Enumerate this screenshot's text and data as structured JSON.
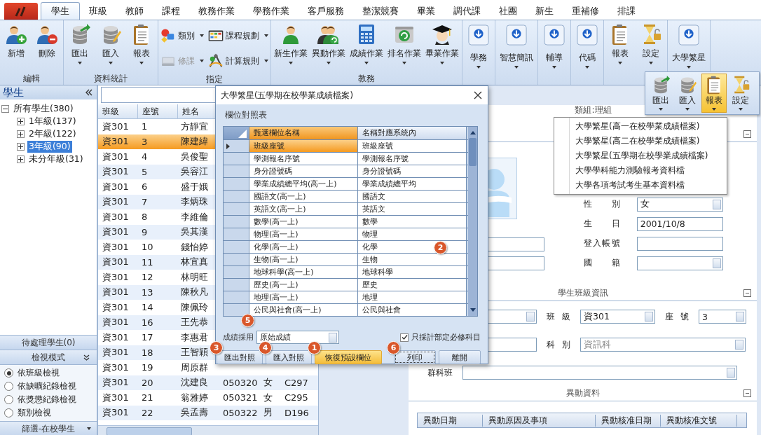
{
  "app_tabs": [
    {
      "label": "學生",
      "selected": true
    },
    {
      "label": "班級",
      "selected": false
    },
    {
      "label": "教師",
      "selected": false
    },
    {
      "label": "課程",
      "selected": false
    },
    {
      "label": "教務作業",
      "selected": false
    },
    {
      "label": "學務作業",
      "selected": false
    },
    {
      "label": "客戶服務",
      "selected": false
    },
    {
      "label": "整潔競賽",
      "selected": false
    },
    {
      "label": "畢業",
      "selected": false
    },
    {
      "label": "調代課",
      "selected": false
    },
    {
      "label": "社團",
      "selected": false
    },
    {
      "label": "新生",
      "selected": false
    },
    {
      "label": "重補修",
      "selected": false
    },
    {
      "label": "排課",
      "selected": false
    }
  ],
  "ribbon_groups": [
    {
      "kind": "large",
      "title": "編輯",
      "buttons": [
        {
          "label": "新增",
          "dropdown": false
        },
        {
          "label": "刪除",
          "dropdown": false
        }
      ]
    },
    {
      "kind": "large",
      "title": "資料統計",
      "buttons": [
        {
          "label": "匯出",
          "dropdown": true
        },
        {
          "label": "匯入",
          "dropdown": true
        },
        {
          "label": "報表",
          "dropdown": true
        }
      ]
    },
    {
      "kind": "small",
      "title": "指定",
      "buttons": [
        {
          "label": "類別",
          "dropdown": true,
          "disabled": false
        },
        {
          "label": "修課",
          "dropdown": true,
          "disabled": true
        },
        {
          "label": "課程規劃",
          "dropdown": true,
          "disabled": false
        },
        {
          "label": "計算規則",
          "dropdown": true,
          "disabled": false
        }
      ]
    },
    {
      "kind": "large",
      "title": "教務",
      "buttons": [
        {
          "label": "新生作業",
          "dropdown": true
        },
        {
          "label": "異動作業",
          "dropdown": true
        },
        {
          "label": "成績作業",
          "dropdown": true
        },
        {
          "label": "排名作業",
          "dropdown": true
        },
        {
          "label": "畢業作業",
          "dropdown": true
        }
      ]
    },
    {
      "kind": "boxed",
      "buttons": [
        {
          "label": "學務",
          "dropdown": true
        }
      ]
    },
    {
      "kind": "boxed",
      "buttons": [
        {
          "label": "智慧簡訊",
          "dropdown": true
        }
      ]
    },
    {
      "kind": "boxed",
      "buttons": [
        {
          "label": "輔導",
          "dropdown": true
        }
      ]
    },
    {
      "kind": "boxed",
      "buttons": [
        {
          "label": "代碼",
          "dropdown": true
        }
      ]
    },
    {
      "kind": "large",
      "buttons": [
        {
          "label": "報表",
          "dropdown": true
        },
        {
          "label": "設定",
          "dropdown": true
        }
      ]
    },
    {
      "kind": "boxed",
      "buttons": [
        {
          "label": "大學繁星",
          "dropdown": true
        }
      ]
    }
  ],
  "side_panel": {
    "title": "學生",
    "tree": {
      "label": "所有學生(380)",
      "expanded": true,
      "selected": false,
      "children": [
        {
          "label": "1年級(137)",
          "expanded": false,
          "selected": false
        },
        {
          "label": "2年級(122)",
          "expanded": false,
          "selected": false
        },
        {
          "label": "3年級(90)",
          "expanded": false,
          "selected": true
        },
        {
          "label": "未分年級(31)",
          "expanded": false,
          "selected": false
        }
      ]
    },
    "pending": "待處理學生(0)",
    "view_mode_title": "檢視模式",
    "view_modes": [
      {
        "label": "依班級檢視",
        "selected": true
      },
      {
        "label": "依缺曠紀錄檢視",
        "selected": false
      },
      {
        "label": "依獎懲紀錄檢視",
        "selected": false
      },
      {
        "label": "類別檢視",
        "selected": false
      }
    ],
    "filter": "篩選-在校學生"
  },
  "student_grid": {
    "columns": [
      "班級",
      "座號",
      "姓名"
    ],
    "rows": [
      {
        "class": "資301",
        "seat": "1",
        "name": "方靜宜",
        "selected": false
      },
      {
        "class": "資301",
        "seat": "3",
        "name": "陳建緯",
        "selected": true
      },
      {
        "class": "資301",
        "seat": "4",
        "name": "吳俊聖",
        "selected": false
      },
      {
        "class": "資301",
        "seat": "5",
        "name": "吳容江",
        "selected": false
      },
      {
        "class": "資301",
        "seat": "6",
        "name": "盛于娥",
        "selected": false
      },
      {
        "class": "資301",
        "seat": "7",
        "name": "李炳珠",
        "selected": false
      },
      {
        "class": "資301",
        "seat": "8",
        "name": "李維倫",
        "selected": false
      },
      {
        "class": "資301",
        "seat": "9",
        "name": "吳其漢",
        "selected": false
      },
      {
        "class": "資301",
        "seat": "10",
        "name": "錢怡婷",
        "selected": false
      },
      {
        "class": "資301",
        "seat": "11",
        "name": "林宜真",
        "selected": false
      },
      {
        "class": "資301",
        "seat": "12",
        "name": "林明旺",
        "selected": false
      },
      {
        "class": "資301",
        "seat": "13",
        "name": "陳秋凡",
        "selected": false
      },
      {
        "class": "資301",
        "seat": "14",
        "name": "陳佩玲",
        "selected": false
      },
      {
        "class": "資301",
        "seat": "16",
        "name": "王先恭",
        "selected": false
      },
      {
        "class": "資301",
        "seat": "17",
        "name": "李惠君",
        "selected": false
      },
      {
        "class": "資301",
        "seat": "18",
        "name": "王智穎",
        "selected": false
      },
      {
        "class": "資301",
        "seat": "19",
        "name": "周原群",
        "selected": false
      },
      {
        "class": "資301",
        "seat": "20",
        "name": "沈建良",
        "student_no": "050320",
        "gender": "女",
        "id_no": "C297",
        "selected": false
      },
      {
        "class": "資301",
        "seat": "21",
        "name": "翁雅婷",
        "student_no": "050321",
        "gender": "女",
        "id_no": "C295",
        "selected": false
      },
      {
        "class": "資301",
        "seat": "22",
        "name": "吳孟壽",
        "student_no": "050322",
        "gender": "男",
        "id_no": "D196",
        "selected": false
      }
    ]
  },
  "detail": {
    "group_label": "類組:理組",
    "profile_fields": [
      {
        "label": "性 別",
        "value": "女",
        "kind": "combo"
      },
      {
        "label": "生 日",
        "value": "2001/10/8",
        "kind": "text"
      },
      {
        "label": "登入帳號",
        "kind": "text"
      },
      {
        "label": "國 籍",
        "kind": "combo"
      }
    ],
    "left_fields": [
      {
        "kind": "text"
      },
      {
        "kind": "text"
      }
    ],
    "class_section": {
      "title": "學生班級資訊",
      "class_label": "班 級",
      "class_value": "資301",
      "seat_label": "座 號",
      "seat_value": "3",
      "dept_label": "科 別",
      "dept_value": "資訊科",
      "dept_disabled": true,
      "group_label": "群科班"
    },
    "changes_section": {
      "title": "異動資料",
      "columns": [
        "異動日期",
        "異動原因及事項",
        "異動核准日期",
        "異動核准文號"
      ]
    }
  },
  "popup_ribbon": [
    {
      "label": "匯出",
      "selected": false
    },
    {
      "label": "匯入",
      "selected": false
    },
    {
      "label": "報表",
      "selected": true
    },
    {
      "label": "設定",
      "selected": false
    }
  ],
  "report_menu": [
    "大學繁星(高一在校學業成績檔案)",
    "大學繁星(高二在校學業成績檔案)",
    "大學繁星(五學期在校學業成績檔案)",
    "大學學科能力測驗報考資料檔",
    "大學各項考試考生基本資料檔"
  ],
  "dialog": {
    "title": "大學繁星(五學期在校學業成績檔案)",
    "table_title": "欄位對照表",
    "callout": "2",
    "columns": [
      {
        "label": "甄選欄位名稱",
        "highlighted": true
      },
      {
        "label": "名稱對應系統內",
        "highlighted": false
      }
    ],
    "rows": [
      {
        "field": "班級座號",
        "mapped": "班級座號",
        "selected": true
      },
      {
        "field": "學測報名序號",
        "mapped": "學測報名序號",
        "selected": false
      },
      {
        "field": "身分證號碼",
        "mapped": "身分證號碼",
        "selected": false
      },
      {
        "field": "學業成績總平均(高一上)",
        "mapped": "學業成績總平均",
        "selected": false
      },
      {
        "field": "國語文(高一上)",
        "mapped": "國語文",
        "selected": false
      },
      {
        "field": "英語文(高一上)",
        "mapped": "英語文",
        "selected": false
      },
      {
        "field": "數學(高一上)",
        "mapped": "數學",
        "selected": false
      },
      {
        "field": "物理(高一上)",
        "mapped": "物理",
        "selected": false
      },
      {
        "field": "化學(高一上)",
        "mapped": "化學",
        "selected": false
      },
      {
        "field": "生物(高一上)",
        "mapped": "生物",
        "selected": false
      },
      {
        "field": "地球科學(高一上)",
        "mapped": "地球科學",
        "selected": false
      },
      {
        "field": "歷史(高一上)",
        "mapped": "歷史",
        "selected": false
      },
      {
        "field": "地理(高一上)",
        "mapped": "地理",
        "selected": false
      },
      {
        "field": "公民與社會(高一上)",
        "mapped": "公民與社會",
        "selected": false
      }
    ],
    "score_label": "成績採用",
    "score_value": "原始成績",
    "score_callout": "5",
    "required_only": {
      "label": "只採計部定必修科目",
      "checked": true
    },
    "left_buttons": [
      {
        "label": "匯出對照",
        "callout": "3",
        "highlighted": false
      },
      {
        "label": "匯入對照",
        "callout": "4",
        "highlighted": false
      },
      {
        "label": "恢復預設欄位",
        "callout": "1",
        "highlighted": true
      }
    ],
    "right_buttons": [
      {
        "label": "列印",
        "callout": "6",
        "focused": true
      },
      {
        "label": "離開",
        "focused": false
      }
    ]
  }
}
